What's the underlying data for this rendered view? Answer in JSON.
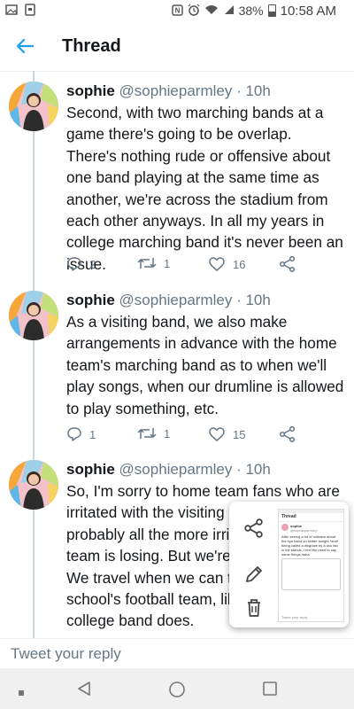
{
  "status_bar": {
    "time": "10:58 AM",
    "battery": "38%",
    "icons": [
      "gallery-icon",
      "notification-box-icon",
      "nfc-icon",
      "alarm-icon",
      "wifi-icon",
      "signal-icon",
      "battery-icon"
    ]
  },
  "header": {
    "title": "Thread",
    "back_icon": "arrow-left-icon"
  },
  "tweets": [
    {
      "name": "sophie",
      "handle": "@sophieparmley",
      "separator": " · ",
      "time": "10h",
      "text": "Second, with two marching bands at a game there's going to be overlap. There's nothing rude or offensive about one band playing at the same time as another, we're across the stadium from each other anyways. In all my years in college marching band it's never been an issue.",
      "replies": "2",
      "retweets": "1",
      "likes": "16"
    },
    {
      "name": "sophie",
      "handle": "@sophieparmley",
      "separator": " · ",
      "time": "10h",
      "text": "As a visiting band, we also make arrangements in advance with the home team's marching band as to when we'll play songs, when our drumline is allowed to play something, etc.",
      "replies": "1",
      "retweets": "1",
      "likes": "15"
    },
    {
      "name": "sophie",
      "handle": "@sophieparmley",
      "separator": " · ",
      "time": "10h",
      "lines": [
        "So, I'm sorry to home team fans who are",
        "irritated with the visiting b",
        "probably all the more irrit",
        "team is losing. But we're",
        "We travel when we can to",
        "school's football team, lik",
        "college band does."
      ]
    }
  ],
  "composer": {
    "placeholder": "Tweet your reply"
  },
  "screenshot_panel": {
    "actions": [
      "share-icon",
      "edit-icon",
      "delete-icon"
    ],
    "thumbnail": {
      "title": "Thread",
      "name": "sophie",
      "handle": "@sophieparmley",
      "text": "After seeing a lot of criticism about the bye band on twitter tonight *and* being called a disgrace by a usu fan in the stands, I feel the need to say some things haha",
      "reply_placeholder": "Tweet your reply"
    }
  },
  "nav_bar": {
    "buttons": [
      "recents-dot-icon",
      "back-triangle-icon",
      "home-circle-icon",
      "overview-square-icon"
    ]
  },
  "colors": {
    "accent": "#1da1f2",
    "secondary_text": "#657786",
    "thread_line": "#ccd6dd"
  }
}
